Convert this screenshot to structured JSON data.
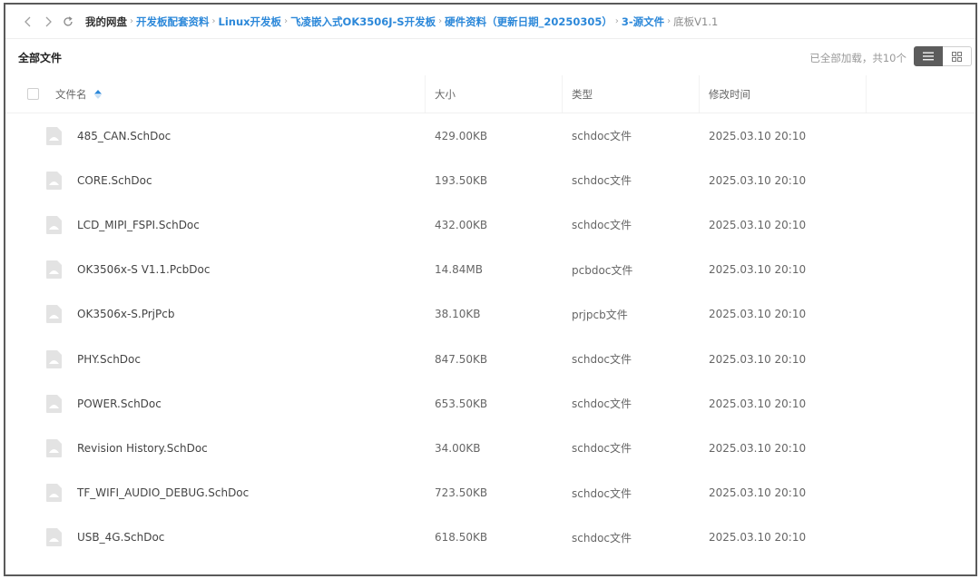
{
  "nav": {
    "back_icon": "chevron-left-icon",
    "forward_icon": "chevron-right-icon",
    "refresh_icon": "refresh-icon",
    "breadcrumb": [
      {
        "label": "我的网盘",
        "kind": "root"
      },
      {
        "label": "开发板配套资料",
        "kind": "link"
      },
      {
        "label": "Linux开发板",
        "kind": "link"
      },
      {
        "label": "飞凌嵌入式OK3506J-S开发板",
        "kind": "link"
      },
      {
        "label": "硬件资料（更新日期_20250305）",
        "kind": "link"
      },
      {
        "label": "3-源文件",
        "kind": "link"
      },
      {
        "label": "底板V1.1",
        "kind": "current"
      }
    ]
  },
  "toolbar": {
    "title": "全部文件",
    "status": "已全部加载，共10个",
    "list_view_icon": "list-view-icon",
    "grid_view_icon": "grid-view-icon"
  },
  "table": {
    "columns": {
      "name": "文件名",
      "size": "大小",
      "type": "类型",
      "modified": "修改时间"
    },
    "sort_icon": "sort-asc-icon",
    "rows": [
      {
        "name": "485_CAN.SchDoc",
        "size": "429.00KB",
        "type": "schdoc文件",
        "modified": "2025.03.10 20:10"
      },
      {
        "name": "CORE.SchDoc",
        "size": "193.50KB",
        "type": "schdoc文件",
        "modified": "2025.03.10 20:10"
      },
      {
        "name": "LCD_MIPI_FSPI.SchDoc",
        "size": "432.00KB",
        "type": "schdoc文件",
        "modified": "2025.03.10 20:10"
      },
      {
        "name": "OK3506x-S V1.1.PcbDoc",
        "size": "14.84MB",
        "type": "pcbdoc文件",
        "modified": "2025.03.10 20:10"
      },
      {
        "name": "OK3506x-S.PrjPcb",
        "size": "38.10KB",
        "type": "prjpcb文件",
        "modified": "2025.03.10 20:10"
      },
      {
        "name": "PHY.SchDoc",
        "size": "847.50KB",
        "type": "schdoc文件",
        "modified": "2025.03.10 20:10"
      },
      {
        "name": "POWER.SchDoc",
        "size": "653.50KB",
        "type": "schdoc文件",
        "modified": "2025.03.10 20:10"
      },
      {
        "name": "Revision History.SchDoc",
        "size": "34.00KB",
        "type": "schdoc文件",
        "modified": "2025.03.10 20:10"
      },
      {
        "name": "TF_WIFI_AUDIO_DEBUG.SchDoc",
        "size": "723.50KB",
        "type": "schdoc文件",
        "modified": "2025.03.10 20:10"
      },
      {
        "name": "USB_4G.SchDoc",
        "size": "618.50KB",
        "type": "schdoc文件",
        "modified": "2025.03.10 20:10"
      }
    ]
  },
  "colors": {
    "link": "#2c88d9",
    "frame_border": "#5a5a5a",
    "active_view_button": "#5c5c5c",
    "sort_icon": "#2c88d9"
  }
}
